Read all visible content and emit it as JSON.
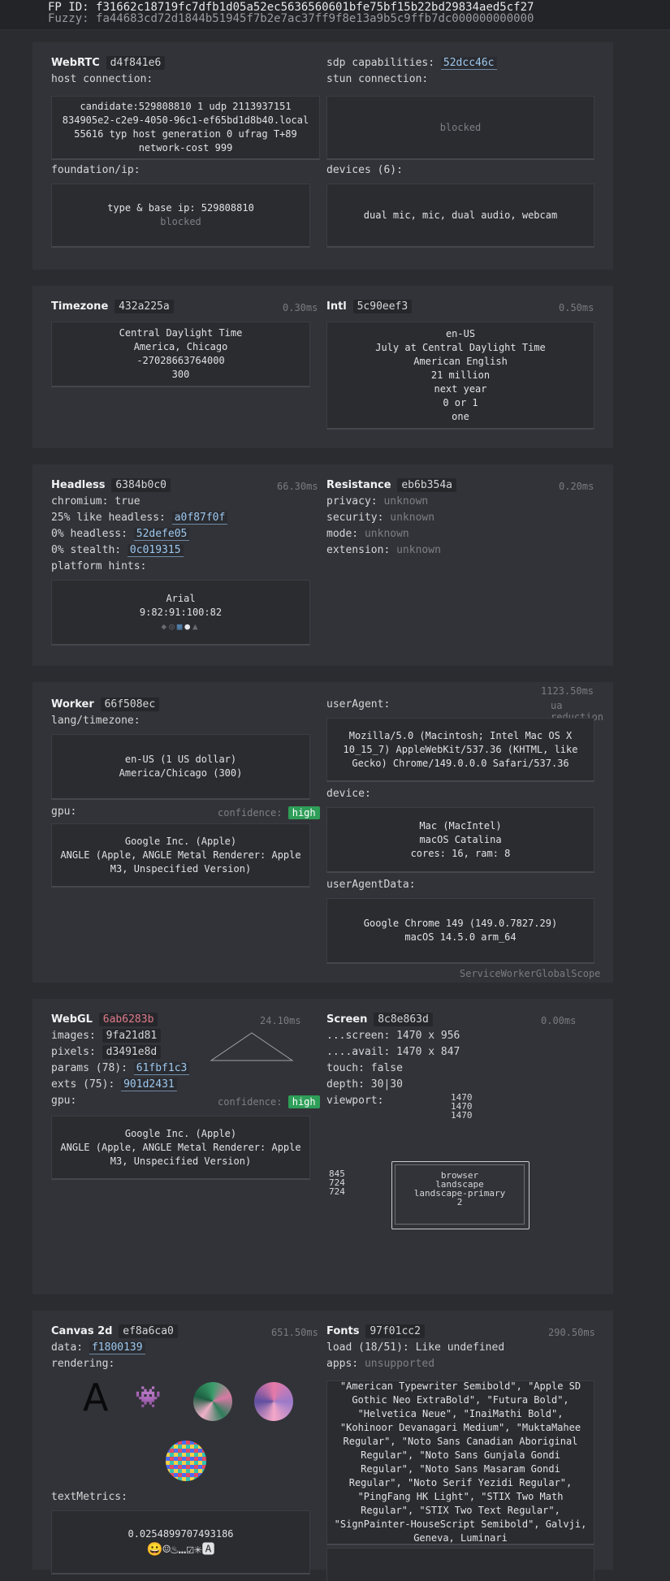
{
  "header": {
    "fp_label": "FP ID:",
    "fp_value": "f31662c18719fc7dfb1d05a52ec5636560601bfe75bf15b22bd29834aed5cf27",
    "fuzzy_label": "Fuzzy:",
    "fuzzy_value": "fa44683cd72d1844b51945f7b2e7ac37ff9f8e13a9b5c9ffb7dc000000000000"
  },
  "webrtc": {
    "title": "WebRTC",
    "hash": "d4f841e6",
    "host_label": "host connection:",
    "candidate": "candidate:529808810 1 udp 2113937151 834905e2-c2e9-4050-96c1-ef65bd1d8b40.local 55616 typ host generation 0 ufrag T+89 network-cost 999",
    "sdp_label": "sdp capabilities:",
    "sdp_hash": "52dcc46c",
    "stun_label": "stun connection:",
    "stun_value": "blocked",
    "foundation_label": "foundation/ip:",
    "foundation_value": "type & base ip: 529808810",
    "foundation_sub": "blocked",
    "devices_label": "devices (6):",
    "devices_value": "dual mic, mic, dual audio, webcam"
  },
  "timezone": {
    "title": "Timezone",
    "hash": "432a225a",
    "ms": "0.30ms",
    "lines": [
      "Central Daylight Time",
      "America, Chicago",
      "-27028663764000",
      "300"
    ]
  },
  "intl": {
    "title": "Intl",
    "hash": "5c90eef3",
    "ms": "0.50ms",
    "lines": [
      "en-US",
      "July at Central Daylight Time",
      "American English",
      "21 million",
      "next year",
      "0 or 1",
      "one"
    ]
  },
  "headless": {
    "title": "Headless",
    "hash": "6384b0c0",
    "ms": "66.30ms",
    "chromium": "chromium: true",
    "like_prefix": "25% like headless:",
    "like_hash": "a0f87f0f",
    "headless_prefix": "0% headless:",
    "headless_hash": "52defe05",
    "stealth_prefix": "0% stealth:",
    "stealth_hash": "0c019315",
    "hints_label": "platform hints:",
    "hints_font": "Arial",
    "hints_values": "9:82:91:100:82"
  },
  "resistance": {
    "title": "Resistance",
    "hash": "eb6b354a",
    "ms": "0.20ms",
    "privacy": "privacy:",
    "security": "security:",
    "mode": "mode:",
    "extension": "extension:",
    "unknown": "unknown"
  },
  "worker": {
    "title": "Worker",
    "hash": "66f508ec",
    "ms": "1123.50ms",
    "ua_reduction": "ua reduction",
    "lang_label": "lang/timezone:",
    "lang_lines": [
      "en-US (1 US dollar)",
      "America/Chicago (300)"
    ],
    "gpu_label": "gpu:",
    "confidence_label": "confidence:",
    "confidence": "high",
    "gpu_lines": [
      "Google Inc. (Apple)",
      "ANGLE (Apple, ANGLE Metal Renderer: Apple M3, Unspecified Version)"
    ],
    "ua_label": "userAgent:",
    "ua_value": "Mozilla/5.0 (Macintosh; Intel Mac OS X 10_15_7) AppleWebKit/537.36 (KHTML, like Gecko) Chrome/149.0.0.0 Safari/537.36",
    "device_label": "device:",
    "device_lines": [
      "Mac (MacIntel)",
      "macOS Catalina",
      "cores: 16, ram: 8"
    ],
    "uad_label": "userAgentData:",
    "uad_lines": [
      "Google Chrome 149 (149.0.7827.29)",
      "macOS 14.5.0 arm_64"
    ],
    "scope": "ServiceWorkerGlobalScope"
  },
  "webgl": {
    "title": "WebGL",
    "hash": "6ab6283b",
    "ms": "24.10ms",
    "images_prefix": "images:",
    "images_hash": "9fa21d81",
    "pixels_prefix": "pixels:",
    "pixels_hash": "d3491e8d",
    "params_prefix": "params (78):",
    "params_hash": "61fbf1c3",
    "exts_prefix": "exts (75):",
    "exts_hash": "901d2431",
    "gpu_label": "gpu:",
    "confidence_label": "confidence:",
    "confidence": "high",
    "gpu_lines": [
      "Google Inc. (Apple)",
      "ANGLE (Apple, ANGLE Metal Renderer: Apple M3, Unspecified Version)"
    ]
  },
  "screen": {
    "title": "Screen",
    "hash": "8c8e863d",
    "ms": "0.00ms",
    "screen": "...screen: 1470 x 956",
    "avail": "....avail: 1470 x 847",
    "touch": "touch: false",
    "depth": "depth: 30|30",
    "viewport_label": "viewport:",
    "vp_top": [
      "1470",
      "1470",
      "1470"
    ],
    "vp_left": [
      "845",
      "724",
      "724"
    ],
    "vp_box": [
      "browser",
      "landscape",
      "landscape-primary",
      "2"
    ]
  },
  "canvas": {
    "title": "Canvas 2d",
    "hash": "ef8a6ca0",
    "ms": "651.50ms",
    "data_prefix": "data:",
    "data_hash": "f1800139",
    "rendering_label": "rendering:",
    "glyph": "A",
    "textmetrics_label": "textMetrics:",
    "textmetrics_value": "0.0254899707493186",
    "emoji": "😀☺♨…☑✳🅰"
  },
  "fonts": {
    "title": "Fonts",
    "hash": "97f01cc2",
    "ms": "290.50ms",
    "load": "load (18/51): Like undefined",
    "apps_label": "apps:",
    "apps_value": "unsupported",
    "list": "\"American Typewriter Semibold\", \"Apple SD Gothic Neo ExtraBold\", \"Futura Bold\", \"Helvetica Neue\", \"InaiMathi Bold\", \"Kohinoor Devanagari Medium\", \"MuktaMahee Regular\", \"Noto Sans Canadian Aboriginal Regular\", \"Noto Sans Gunjala Gondi Regular\", \"Noto Sans Masaram Gondi Regular\", \"Noto Serif Yezidi Regular\", \"PingFang HK Light\", \"STIX Two Math Regular\", \"STIX Two Text Regular\", \"SignPainter-HouseScript Semibold\", Galvji, Geneva, Luminari"
  },
  "colors": {
    "bg": "#2b2c30",
    "panel": "#323338",
    "link": "#9ec8ee",
    "badge": "#2e9e58",
    "red_hash": "#e07a8b"
  }
}
